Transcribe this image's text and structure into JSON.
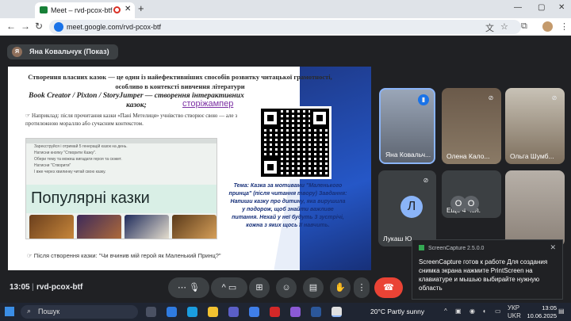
{
  "browser": {
    "tab_title": "Meet – rvd-pcox-btf",
    "url": "meet.google.com/rvd-pcox-btf"
  },
  "meeting": {
    "presenter_initial": "Я",
    "presenter_label": "Яна Ковальчук (Показ)",
    "clock": "13:05",
    "divider": "|",
    "meeting_code": "rvd-pcox-btf"
  },
  "slide": {
    "title": "Створення власних казок — це один із найефективніших способів розвитку читацької грамотності, особливо в контексті вивчення літератури",
    "tools": "Book Creator / Pixton / StoryJumper — створення інтерактивних казок;",
    "link": "сторіжампер",
    "example": "☞ Наприклад: після прочитання казки «Пані Метелиця» учнівство створює свою — але з протилежною мораллю або сучасним контекстом.",
    "shot_items": [
      "Зареєструйся і отримай 5 генерацій казок на день.",
      "Натисни кнопку \"Створити Казку\".",
      "Обери тему та можеш вигадати героя та сюжет.",
      "Натисни \"Створити\"",
      "І вже через хвилинку читай свою казку."
    ],
    "popular": "Популярні казки",
    "theme": "Тема: Казка за мотивами \"Маленького принца\" (після читання твору) Завдання: Напиши казку про дитину, яка вирушила у подорож, щоб знайти важливе питання. Нехай у неї будуть 3 зустрічі, кожна з яких щось її навчить.",
    "after": "☞ Після створення казки: \"Чи вчинив мій герой як Маленький Принц?\""
  },
  "participants": [
    {
      "name": "Яна Ковальч..."
    },
    {
      "name": "Олена Кало..."
    },
    {
      "name": "Ольга Шумб..."
    },
    {
      "initial": "Л",
      "name": "Лукаш Ю..."
    },
    {
      "initial_a": "О",
      "initial_b": "О",
      "name": "Ещё 4 чел."
    }
  ],
  "notification": {
    "app": "ScreenCapture 2.5.0.0",
    "body": "ScreenCapture готов к работе Для создания снимка экрана нажмите PrintScreen на клавиатуре и мышью выбирайте нужную область"
  },
  "taskbar": {
    "search": "Пошук",
    "weather": "20°C  Partly sunny",
    "lang1": "УКР",
    "lang2": "UKR",
    "time": "13:05",
    "date": "10.06.2025"
  },
  "colors": {
    "end_call": "#ea4335",
    "accent": "#1a73e8"
  }
}
